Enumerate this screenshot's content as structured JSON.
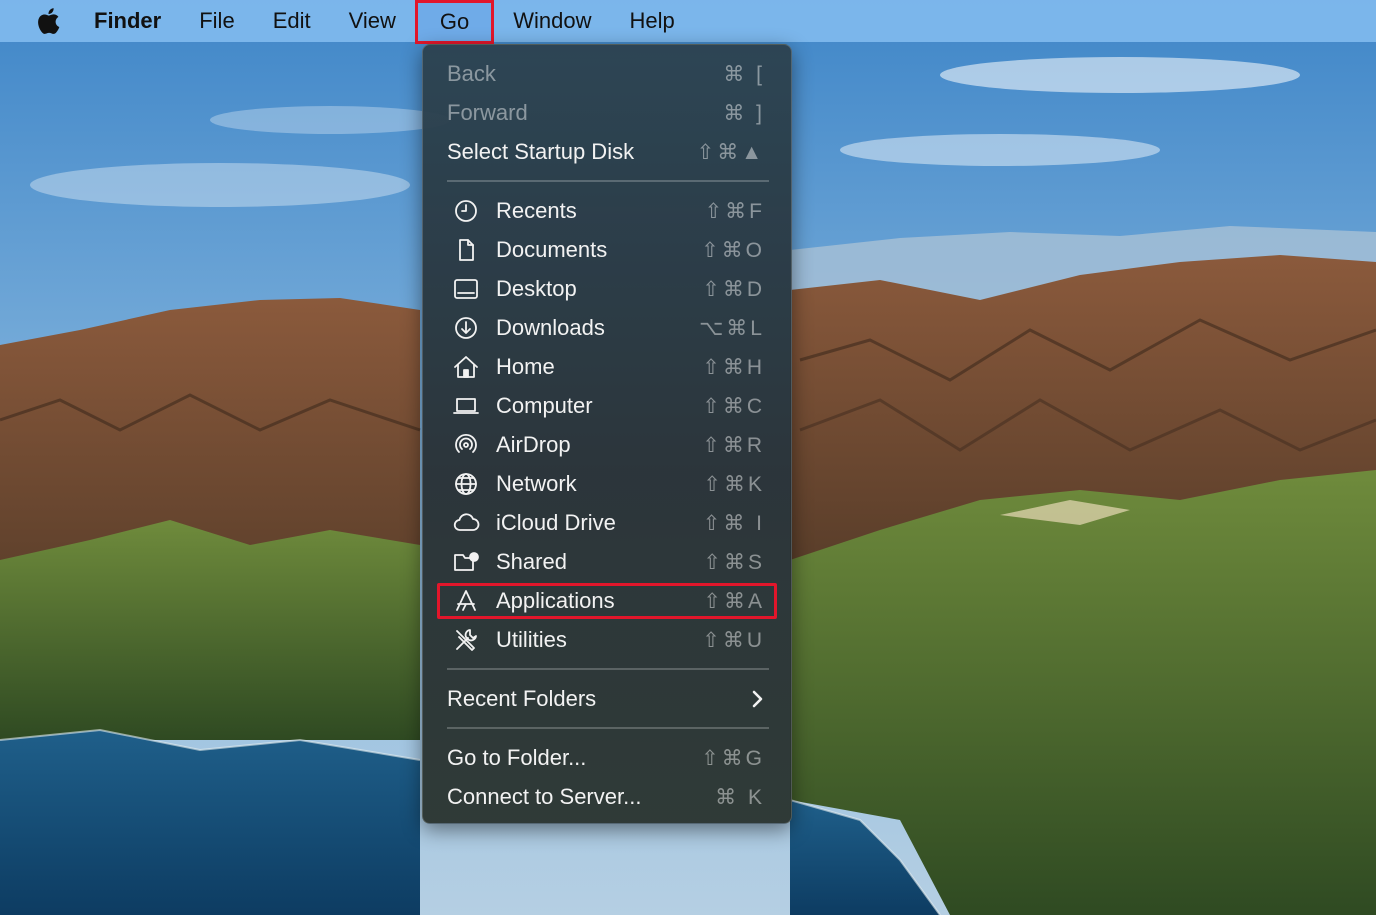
{
  "menubar": {
    "apple_icon": "apple-logo-icon",
    "app_name": "Finder",
    "menus": [
      "File",
      "Edit",
      "View",
      "Go",
      "Window",
      "Help"
    ],
    "active_menu": "Go"
  },
  "go_menu": {
    "nav": [
      {
        "label": "Back",
        "shortcut": "⌘ [",
        "disabled": true
      },
      {
        "label": "Forward",
        "shortcut": "⌘ ]",
        "disabled": true
      },
      {
        "label": "Select Startup Disk",
        "shortcut": "⇧⌘▲",
        "disabled": false
      }
    ],
    "places": [
      {
        "label": "Recents",
        "shortcut": "⇧⌘F",
        "icon": "clock-icon"
      },
      {
        "label": "Documents",
        "shortcut": "⇧⌘O",
        "icon": "document-icon"
      },
      {
        "label": "Desktop",
        "shortcut": "⇧⌘D",
        "icon": "desktop-icon"
      },
      {
        "label": "Downloads",
        "shortcut": "⌥⌘L",
        "icon": "download-icon"
      },
      {
        "label": "Home",
        "shortcut": "⇧⌘H",
        "icon": "home-icon"
      },
      {
        "label": "Computer",
        "shortcut": "⇧⌘C",
        "icon": "laptop-icon"
      },
      {
        "label": "AirDrop",
        "shortcut": "⇧⌘R",
        "icon": "airdrop-icon"
      },
      {
        "label": "Network",
        "shortcut": "⇧⌘K",
        "icon": "globe-icon"
      },
      {
        "label": "iCloud Drive",
        "shortcut": "⇧⌘ I",
        "icon": "cloud-icon"
      },
      {
        "label": "Shared",
        "shortcut": "⇧⌘S",
        "icon": "shared-folder-icon"
      },
      {
        "label": "Applications",
        "shortcut": "⇧⌘A",
        "icon": "applications-icon"
      },
      {
        "label": "Utilities",
        "shortcut": "⇧⌘U",
        "icon": "utilities-icon"
      }
    ],
    "recent_folders": {
      "label": "Recent Folders",
      "icon": "chevron-right-icon"
    },
    "goto": [
      {
        "label": "Go to Folder...",
        "shortcut": "⇧⌘G"
      },
      {
        "label": "Connect to Server...",
        "shortcut": "⌘ K"
      }
    ]
  },
  "highlight_colors": {
    "annotation": "#e2162b"
  }
}
